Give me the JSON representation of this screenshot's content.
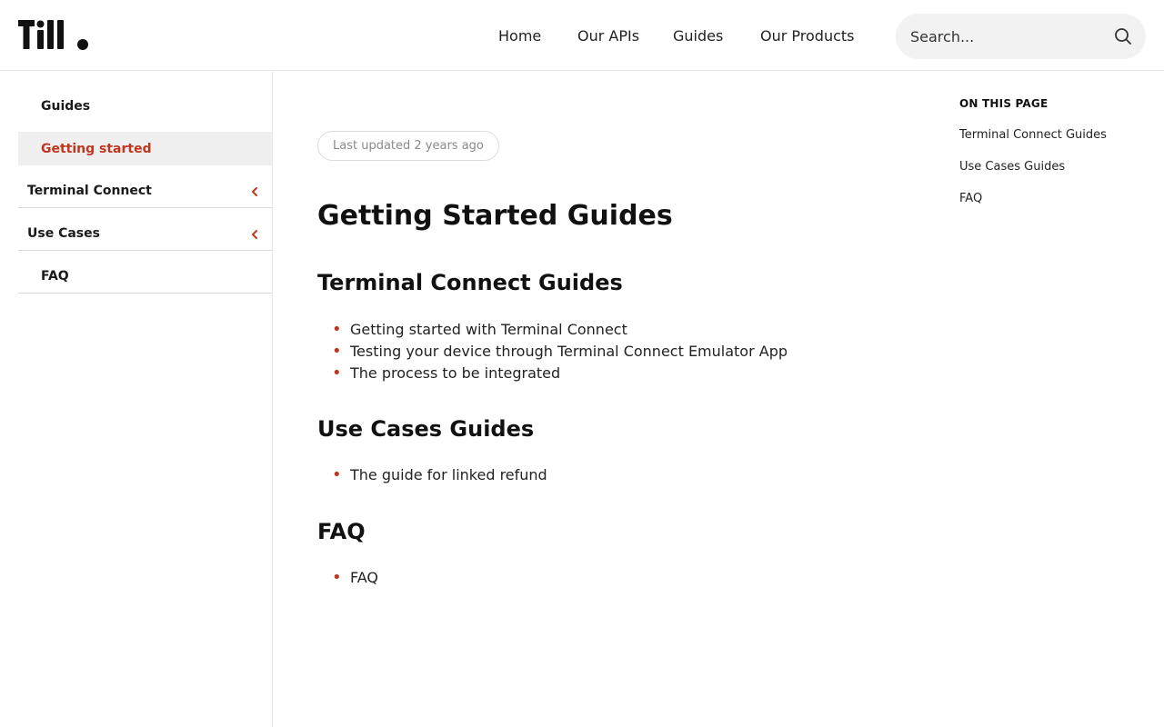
{
  "brand": {
    "logo_text": "Till."
  },
  "nav": {
    "items": [
      {
        "label": "Home"
      },
      {
        "label": "Our APIs"
      },
      {
        "label": "Guides"
      },
      {
        "label": "Our Products"
      }
    ]
  },
  "search": {
    "placeholder": "Search..."
  },
  "sidebar": {
    "items": [
      {
        "label": "Guides",
        "active": false,
        "expandable": false
      },
      {
        "label": "Getting started",
        "active": true,
        "expandable": false
      },
      {
        "label": "Terminal Connect",
        "active": false,
        "expandable": true
      },
      {
        "label": "Use Cases",
        "active": false,
        "expandable": true
      },
      {
        "label": "FAQ",
        "active": false,
        "expandable": false
      }
    ]
  },
  "main": {
    "last_updated": "Last updated 2 years ago",
    "title": "Getting Started Guides",
    "sections": [
      {
        "heading": "Terminal Connect Guides",
        "items": [
          "Getting started with Terminal Connect",
          "Testing your device through Terminal Connect Emulator App",
          "The process to be integrated"
        ]
      },
      {
        "heading": "Use Cases Guides",
        "items": [
          "The guide for linked refund"
        ]
      },
      {
        "heading": "FAQ",
        "items": [
          "FAQ"
        ]
      }
    ]
  },
  "toc": {
    "title": "ON THIS PAGE",
    "links": [
      "Terminal Connect Guides",
      "Use Cases Guides",
      "FAQ"
    ]
  },
  "colors": {
    "accent": "#c0361e",
    "text": "#111111",
    "active_bg": "#efefef"
  }
}
